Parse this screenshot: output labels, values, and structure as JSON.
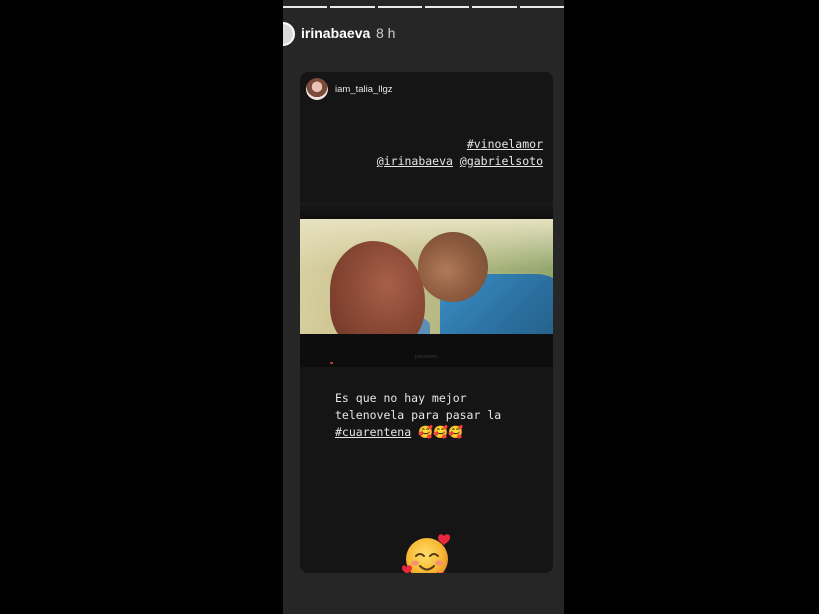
{
  "story": {
    "username": "irinabaeva",
    "time": "8 h",
    "progress_segments": 6
  },
  "shared_post": {
    "username": "iam_talia_llgz",
    "hashtag_line": "#vinoelamor",
    "mention_1": "@irinabaeva",
    "mention_2": "@gabrielsoto",
    "caption_line_1": "Es que no hay mejor",
    "caption_line_2": "telenovela para pasar la",
    "caption_hashtag": "#cuarentena",
    "caption_emojis": "🥰🥰🥰",
    "tv_brand": "panasonic"
  },
  "sticker": {
    "emoji": "🥰"
  },
  "colors": {
    "story_bg": "#262626",
    "card_bg": "#151515",
    "text": "#e6e6e6"
  }
}
